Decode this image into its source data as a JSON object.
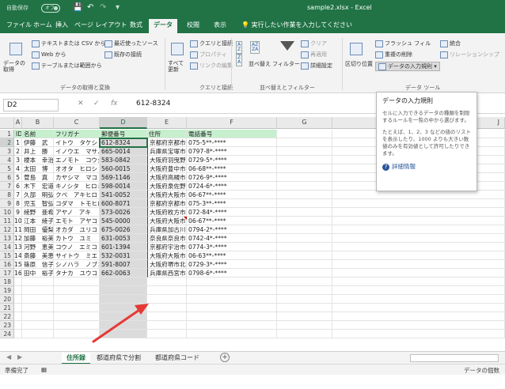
{
  "titlebar": {
    "autosave_label": "自動保存",
    "autosave_state": "オフ",
    "doc_title": "sample2.xlsx  -  Excel"
  },
  "tabs": [
    "ファイル",
    "ホーム",
    "挿入",
    "ページ レイアウト",
    "数式",
    "データ",
    "校閲",
    "表示"
  ],
  "active_tab": "データ",
  "tell_me": "実行したい作業を入力してください",
  "ribbon": {
    "get_data_label": "データの取得",
    "text_csv": "テキストまたは CSV から",
    "from_web": "Web から",
    "from_table": "テーブルまたは範囲から",
    "recent_sources": "最近使ったソース",
    "existing_connections": "既存の接続",
    "group1_label": "データの取得と変換",
    "refresh_all": "すべて更新",
    "queries_connections": "クエリと接続",
    "properties": "プロパティ",
    "edit_links": "リンクの編集",
    "group2_label": "クエリと接続",
    "sort": "並べ替え",
    "filter": "フィルター",
    "clear": "クリア",
    "reapply": "再適用",
    "advanced": "詳細設定",
    "group3_label": "並べ替えとフィルター",
    "text_to_columns": "区切り位置",
    "flash_fill": "フラッシュ フィル",
    "remove_duplicates": "重複の削除",
    "data_validation": "データの入力規則",
    "consolidate": "統合",
    "relationships": "リレーションシップ",
    "group4_label": "データ ツール"
  },
  "formula_bar": {
    "name_box": "D2",
    "fx": "fx",
    "value": "612-8324"
  },
  "columns": [
    {
      "letter": "A"
    },
    {
      "letter": "B"
    },
    {
      "letter": "C"
    },
    {
      "letter": "D"
    },
    {
      "letter": "E"
    },
    {
      "letter": "F"
    },
    {
      "letter": "G"
    },
    {
      "letter": "J"
    }
  ],
  "selected_column": "D",
  "header_row": [
    "ID",
    "名前",
    "フリガナ",
    "郵便番号",
    "住所",
    "電話番号"
  ],
  "rows": [
    [
      "1",
      "伊藤　武",
      "イトウ　タケシ",
      "612-8324",
      "京都府京都市伏見区小豆屋町",
      "075-5**-****"
    ],
    [
      "2",
      "井上　勝",
      "イノウエ　マサル",
      "665-0014",
      "兵庫県宝塚市青葉台",
      "0797-8*-****"
    ],
    [
      "3",
      "榎本　幸治",
      "エノモト　コウジ",
      "583-0842",
      "大阪府羽曳野市飛鳥",
      "0729-5*-****"
    ],
    [
      "4",
      "太田　博",
      "オオタ　ヒロシ",
      "560-0015",
      "大阪府豊中市赤阪",
      "06-68**-****"
    ],
    [
      "5",
      "菅島　真",
      "カヤシマ　マコト",
      "569-1146",
      "大阪府高槻市赤大路町",
      "0726-9*-****"
    ],
    [
      "6",
      "木下　宏道",
      "キノシタ　ヒロミチ",
      "598-0014",
      "大阪府泉佐野市葵町",
      "0724-6*-****"
    ],
    [
      "7",
      "久部　明弘",
      "クベ　アキヒロ",
      "541-0052",
      "大阪府大阪市中央区安土町",
      "06-67**-****"
    ],
    [
      "8",
      "児玉　智弘",
      "コダマ　トモヒロ",
      "600-8071",
      "京都府京都市下京区相之町",
      "075-3**-****"
    ],
    [
      "9",
      "綾野　亜希",
      "アヤノ　アキ",
      "573-0026",
      "大阪府枚方市朝日丘町",
      "072-84*-****"
    ],
    [
      "10",
      "江本　綾子",
      "エモト　アヤコ",
      "545-0000",
      "大阪府大阪市阿倍野区",
      "06-67**-****"
    ],
    [
      "11",
      "岡田　優梨子",
      "オカダ　ユリコ",
      "675-0026",
      "兵庫県加古川市尾上町旭",
      "0794-2*-****"
    ],
    [
      "12",
      "加藤　裕美",
      "カトウ　ユミ",
      "631-0053",
      "奈良県奈良市青垣台",
      "0742-4*-****"
    ],
    [
      "13",
      "河野　恵美子",
      "コウノ　エミコ",
      "601-1394",
      "京都府宇治市池尾",
      "0774-3*-****"
    ],
    [
      "14",
      "斎藤　美恵",
      "サイトウ　ミエ",
      "532-0031",
      "大阪府大阪市淀川区加島",
      "06-63**-****"
    ],
    [
      "15",
      "篠原　信子",
      "シノハラ　ノブコ",
      "591-8007",
      "大阪府堺市北区奥本町",
      "0729-3*-****"
    ],
    [
      "16",
      "田中　裕子",
      "タナカ　ユウコ",
      "662-0063",
      "兵庫県西宮市相生町",
      "0798-6*-****"
    ]
  ],
  "row_numbers": [
    "1",
    "2",
    "3",
    "4",
    "5",
    "6",
    "7",
    "8",
    "9",
    "10",
    "11",
    "12",
    "13",
    "14",
    "15",
    "16",
    "17",
    "18",
    "19",
    "20",
    "21",
    "22",
    "23",
    "24"
  ],
  "tooltip": {
    "title": "データの入力規則",
    "body1": "セルに入力できるデータの種類を制限するルールを一覧の中から選びます。",
    "body2": "たとえば、1、2、3 などの値のリストを表示したり、1000 よりも大きい数値のみを有効値として許可したりできます。",
    "help": "詳細情報"
  },
  "sheet_tabs": [
    "住所録",
    "都道府県で分割",
    "都道府県コード"
  ],
  "active_sheet": "住所録",
  "status": {
    "ready": "準備完了",
    "right": "データの個数"
  },
  "colors": {
    "excel_green": "#217346",
    "header_fill": "#c6efce",
    "selected_col": "#dbdbdb",
    "arrow": "#e53935"
  }
}
